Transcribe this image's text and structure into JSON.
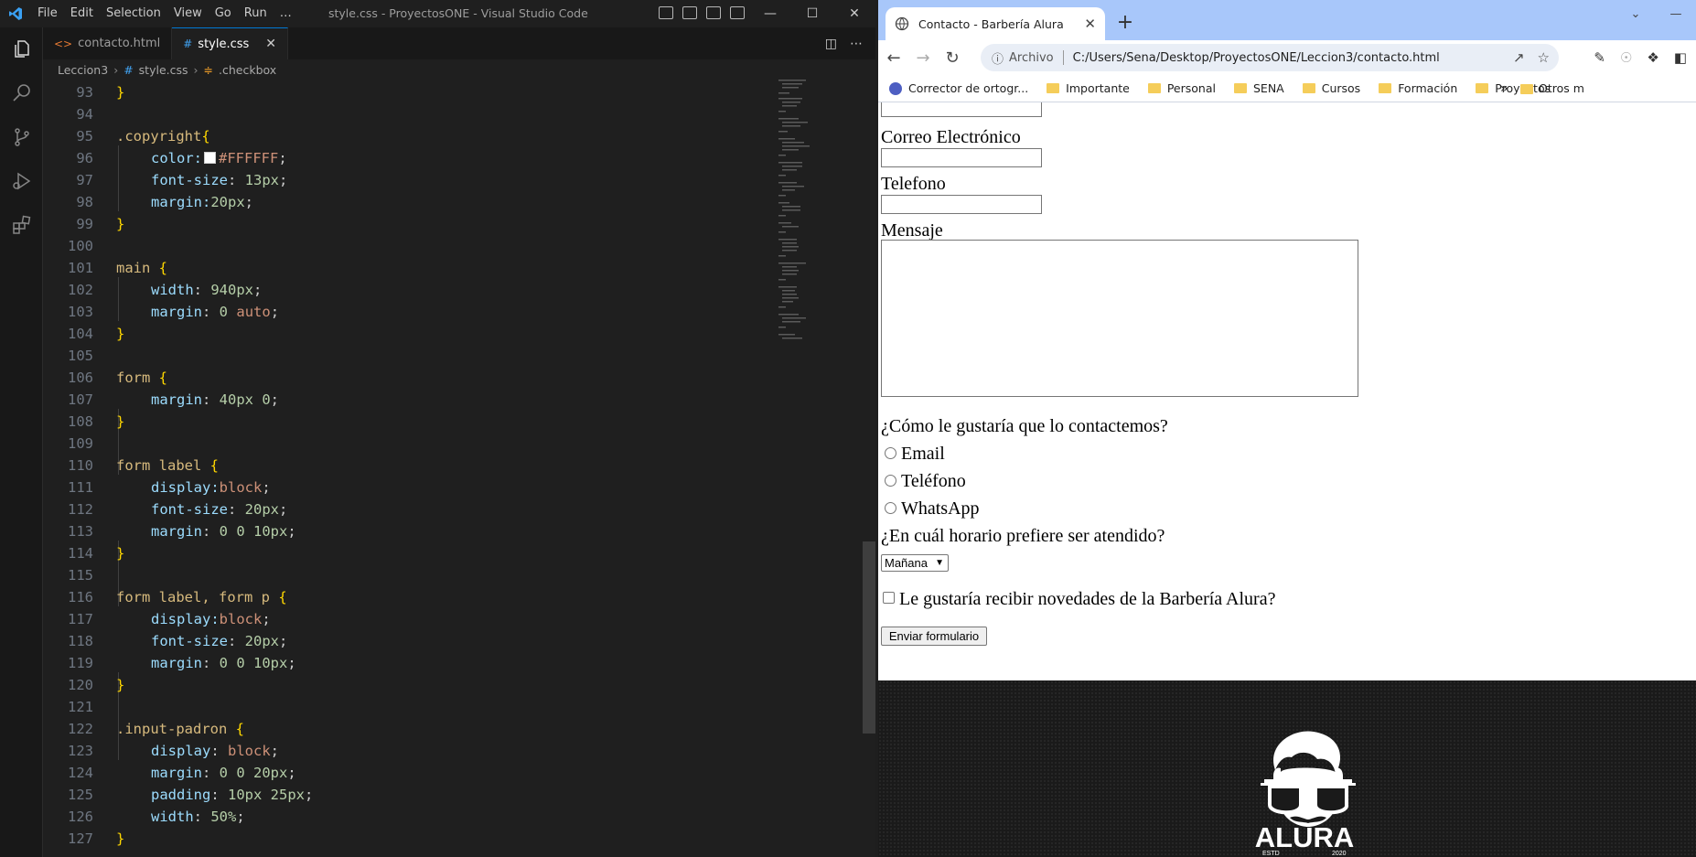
{
  "vscode": {
    "menu": [
      "File",
      "Edit",
      "Selection",
      "View",
      "Go",
      "Run",
      "…"
    ],
    "window_title": "style.css - ProyectosONE - Visual Studio Code",
    "tabs": [
      {
        "label": "contacto.html",
        "icon": "html-file-icon",
        "active": false
      },
      {
        "label": "style.css",
        "icon": "css-file-icon",
        "active": true
      }
    ],
    "breadcrumb": [
      "Leccion3",
      "style.css",
      ".checkbox"
    ],
    "lines": [
      {
        "n": "93"
      },
      {
        "n": "94"
      },
      {
        "n": "95"
      },
      {
        "n": "96"
      },
      {
        "n": "97"
      },
      {
        "n": "98"
      },
      {
        "n": "99"
      },
      {
        "n": "100"
      },
      {
        "n": "101"
      },
      {
        "n": "102"
      },
      {
        "n": "103"
      },
      {
        "n": "104"
      },
      {
        "n": "105"
      },
      {
        "n": "106"
      },
      {
        "n": "107"
      },
      {
        "n": "108"
      },
      {
        "n": "109"
      },
      {
        "n": "110"
      },
      {
        "n": "111"
      },
      {
        "n": "112"
      },
      {
        "n": "113"
      },
      {
        "n": "114"
      },
      {
        "n": "115"
      },
      {
        "n": "116"
      },
      {
        "n": "117"
      },
      {
        "n": "118"
      },
      {
        "n": "119"
      },
      {
        "n": "120"
      },
      {
        "n": "121"
      },
      {
        "n": "122"
      },
      {
        "n": "123"
      },
      {
        "n": "124"
      },
      {
        "n": "125"
      },
      {
        "n": "126"
      },
      {
        "n": "127"
      }
    ],
    "code": {
      "l93": "}",
      "l95_sel": ".copyright",
      "l96_prop": "color:",
      "l96_val": "#FFFFFF",
      "l97_prop": "font-size",
      "l97_val": "13px",
      "l98_prop": "margin:",
      "l98_val": "20px",
      "l101_sel": "main",
      "l102_prop": "width",
      "l102_val": "940px",
      "l103_prop": "margin",
      "l103_num": "0",
      "l103_val": "auto",
      "l106_sel": "form",
      "l107_prop": "margin",
      "l107_val": "40px 0",
      "l110_sel": "form label",
      "l111_prop": "display:",
      "l111_val": "block",
      "l112_prop": "font-size",
      "l112_val": "20px",
      "l113_prop": "margin",
      "l113_val": "0 0 10px",
      "l116_sel": "form label, form p",
      "l117_prop": "display:",
      "l117_val": "block",
      "l118_prop": "font-size",
      "l118_val": "20px",
      "l119_prop": "margin",
      "l119_val": "0 0 10px",
      "l122_sel": ".input-padron",
      "l123_prop": "display",
      "l123_val": "block",
      "l124_prop": "margin",
      "l124_val": "0 0 20px",
      "l125_prop": "padding",
      "l125_val": "10px 25px",
      "l126_prop": "width",
      "l126_val": "50%"
    }
  },
  "browser": {
    "tab_title": "Contacto - Barbería Alura",
    "address_security": "Archivo",
    "address_url": "C:/Users/Sena/Desktop/ProyectosONE/Leccion3/contacto.html",
    "bookmarks": [
      "Corrector de ortogr...",
      "Importante",
      "Personal",
      "SENA",
      "Cursos",
      "Formación",
      "Proyectos"
    ],
    "bookmarks_more": "»",
    "bookmarks_other": "Otros m"
  },
  "page": {
    "label_email": "Correo Electrónico",
    "label_phone": "Telefono",
    "label_message": "Mensaje",
    "contact_question": "¿Cómo le gustaría que lo contactemos?",
    "radio_options": [
      "Email",
      "Teléfono",
      "WhatsApp"
    ],
    "schedule_question": "¿En cuál horario prefiere ser atendido?",
    "schedule_selected": "Mañana",
    "newsletter_label": "Le gustaría recibir novedades de la Barbería Alura?",
    "submit_label": "Enviar formulario",
    "logo_text": "ALURA",
    "logo_estd": "ESTD",
    "logo_year": "2020"
  },
  "colors": {
    "vscode_bg": "#1f1f1f",
    "browser_tabbar": "#a8c7fa",
    "selector": "#d7ba7d",
    "property": "#9cdcfe",
    "number": "#b5cea8",
    "string_value": "#ce9178",
    "bracket": "#ffd700"
  }
}
